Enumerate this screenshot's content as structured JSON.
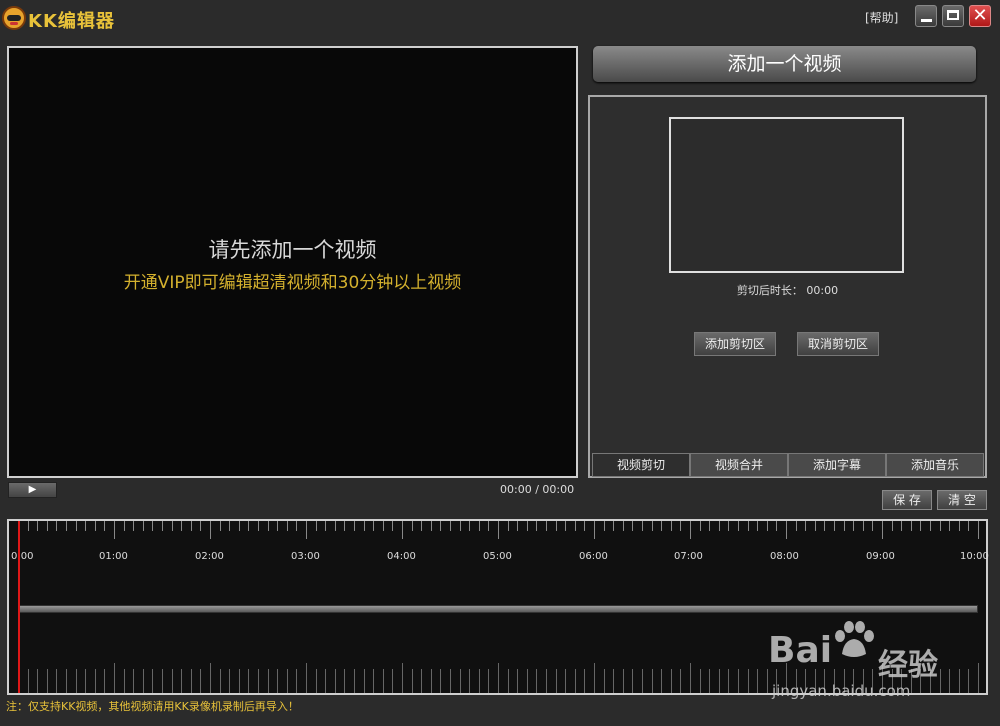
{
  "app": {
    "title": "KK编辑器",
    "help_label": "[帮助]",
    "close_glyph": "✕"
  },
  "player": {
    "message": "请先添加一个视频",
    "vip_message": "开通VIP即可编辑超清视频和30分钟以上视频",
    "play_glyph": "▶",
    "timecode": "00:00 / 00:00"
  },
  "right_panel": {
    "add_video_label": "添加一个视频",
    "duration_label": "剪切后时长：",
    "duration_value": "00:00",
    "add_cut_label": "添加剪切区",
    "cancel_cut_label": "取消剪切区",
    "tabs": [
      {
        "label": "视频剪切",
        "active": true
      },
      {
        "label": "视频合并",
        "active": false
      },
      {
        "label": "添加字幕",
        "active": false
      },
      {
        "label": "添加音乐",
        "active": false
      }
    ]
  },
  "actions": {
    "save_label": "保 存",
    "clear_label": "清 空"
  },
  "timeline": {
    "labels": [
      "0:00",
      "01:00",
      "02:00",
      "03:00",
      "04:00",
      "05:00",
      "06:00",
      "07:00",
      "08:00",
      "09:00",
      "10:00"
    ]
  },
  "footer": {
    "note": "注：仅支持KK视频，其他视频请用KK录像机录制后再导入！"
  },
  "watermark": {
    "brand": "Bai",
    "brand_cn": "经验",
    "url": "jingyan.baidu.com"
  },
  "colors": {
    "accent_yellow": "#d4b12e",
    "cursor_red": "#e01818",
    "close_red": "#c02020"
  }
}
